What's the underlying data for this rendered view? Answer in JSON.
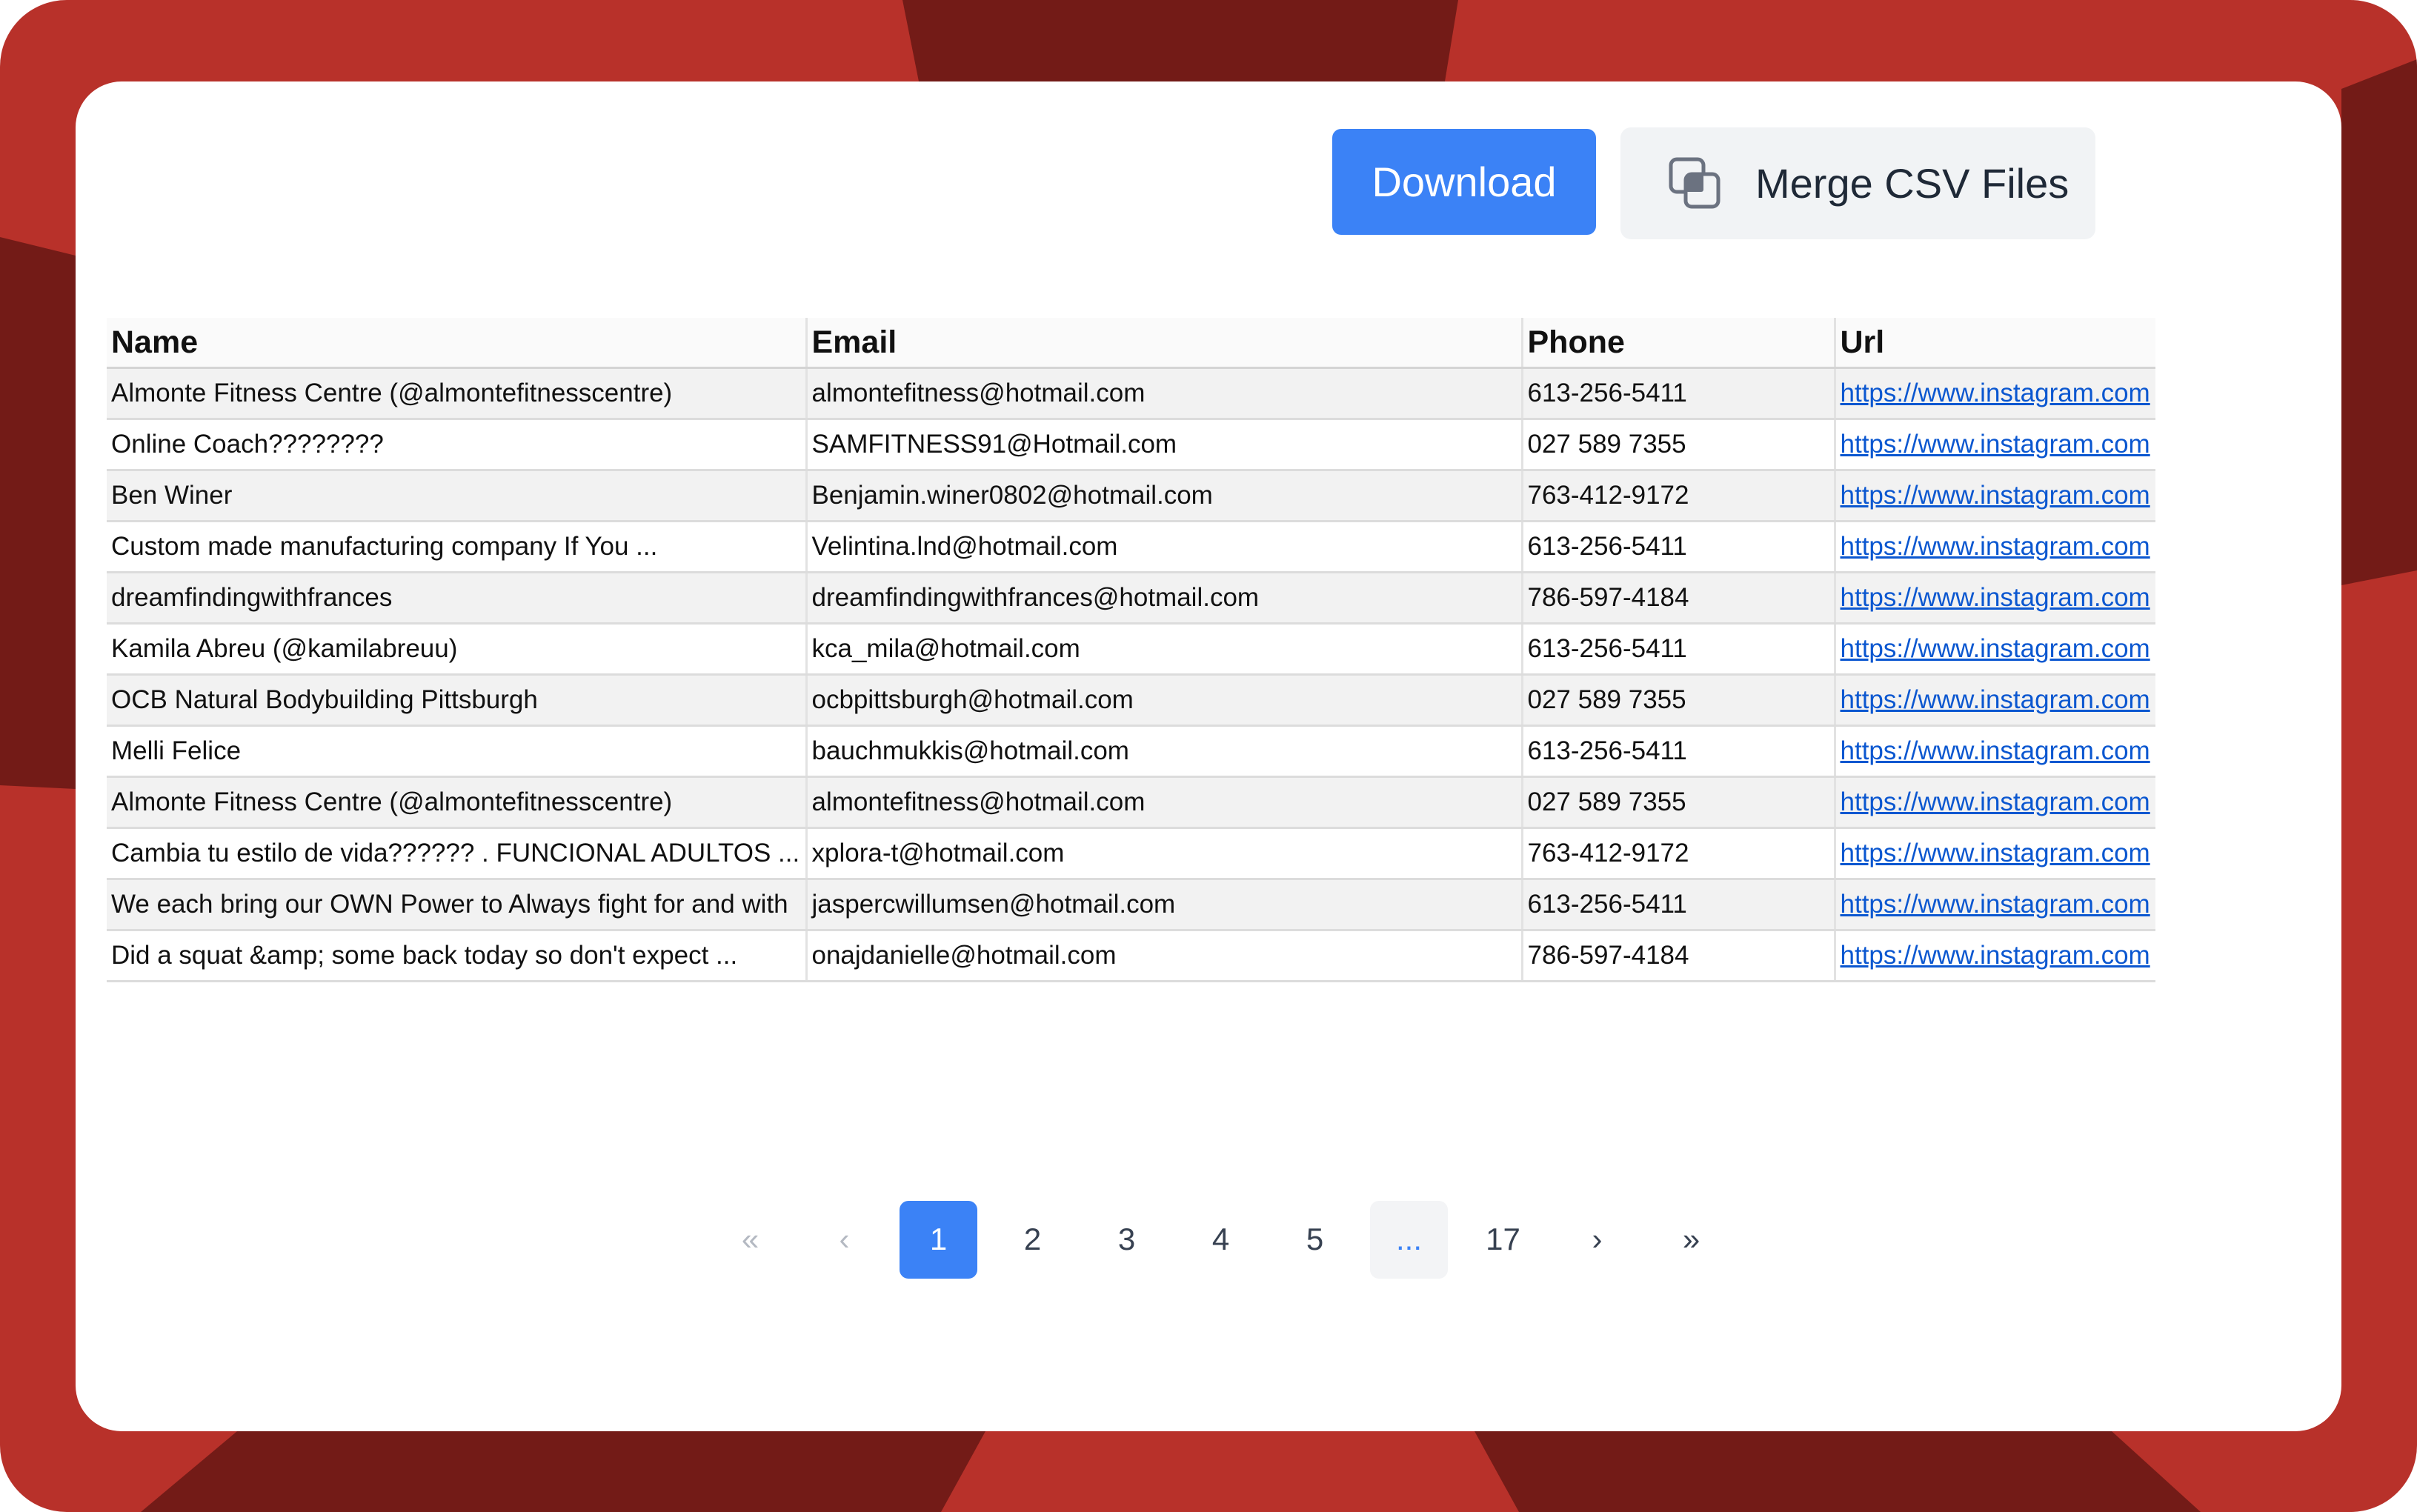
{
  "toolbar": {
    "download_label": "Download",
    "merge_label": "Merge CSV Files"
  },
  "table": {
    "columns": [
      "Name",
      "Email",
      "Phone",
      "Url"
    ],
    "rows": [
      {
        "name": "Almonte Fitness Centre (@almontefitnesscentre)",
        "email": "almontefitness@hotmail.com",
        "phone": "613-256-5411",
        "url": "https://www.instagram.com"
      },
      {
        "name": "Online Coach????????",
        "email": "SAMFITNESS91@Hotmail.com",
        "phone": "027 589 7355",
        "url": "https://www.instagram.com"
      },
      {
        "name": "Ben Winer",
        "email": "Benjamin.winer0802@hotmail.com",
        "phone": "763-412-9172",
        "url": "https://www.instagram.com"
      },
      {
        "name": "Custom made manufacturing company If You ...",
        "email": "Velintina.lnd@hotmail.com",
        "phone": "613-256-5411",
        "url": "https://www.instagram.com"
      },
      {
        "name": "dreamfindingwithfrances",
        "email": "dreamfindingwithfrances@hotmail.com",
        "phone": "786-597-4184",
        "url": "https://www.instagram.com"
      },
      {
        "name": "Kamila Abreu (@kamilabreuu)",
        "email": "kca_mila@hotmail.com",
        "phone": "613-256-5411",
        "url": "https://www.instagram.com"
      },
      {
        "name": "OCB Natural Bodybuilding Pittsburgh",
        "email": "ocbpittsburgh@hotmail.com",
        "phone": "027 589 7355",
        "url": "https://www.instagram.com"
      },
      {
        "name": "Melli Felice",
        "email": "bauchmukkis@hotmail.com",
        "phone": "613-256-5411",
        "url": "https://www.instagram.com"
      },
      {
        "name": "Almonte Fitness Centre (@almontefitnesscentre)",
        "email": "almontefitness@hotmail.com",
        "phone": "027 589 7355",
        "url": "https://www.instagram.com"
      },
      {
        "name": "Cambia tu estilo de vida?????? . FUNCIONAL ADULTOS ...",
        "email": "xplora-t@hotmail.com",
        "phone": "763-412-9172",
        "url": "https://www.instagram.com"
      },
      {
        "name": "We each bring our OWN Power to Always fight for and with",
        "email": "jaspercwillumsen@hotmail.com",
        "phone": "613-256-5411",
        "url": "https://www.instagram.com"
      },
      {
        "name": "Did a squat &amp; some back today so don't expect ...",
        "email": "onajdanielle@hotmail.com",
        "phone": "786-597-4184",
        "url": "https://www.instagram.com"
      }
    ]
  },
  "pagination": {
    "first": "«",
    "prev": "‹",
    "pages": [
      "1",
      "2",
      "3",
      "4",
      "5"
    ],
    "ellipsis": "...",
    "last_page": "17",
    "next": "›",
    "last": "»",
    "current": "1"
  },
  "colors": {
    "frame": "#b8312a",
    "frame_dark": "#731b17",
    "accent": "#3b82f6",
    "link": "#0b57d0"
  }
}
